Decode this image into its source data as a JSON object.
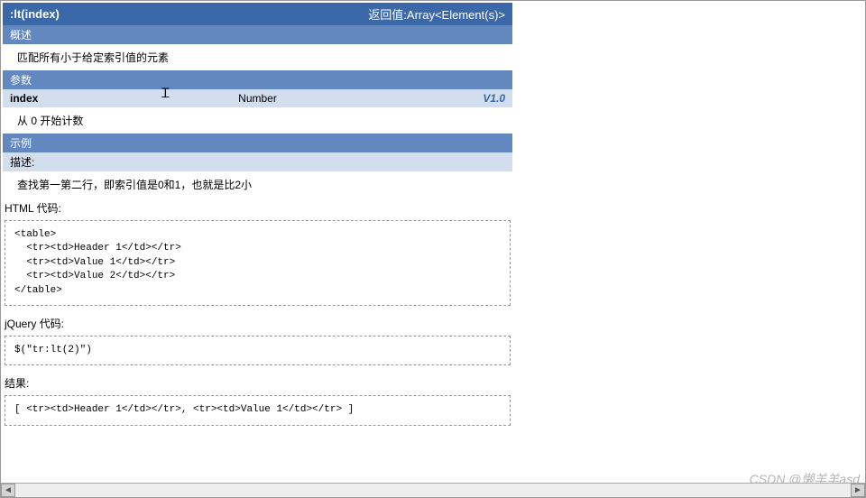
{
  "title": ":lt(index)",
  "return_label": "返回值:Array<Element(s)>",
  "sections": {
    "overview": "概述",
    "params": "参数",
    "example": "示例"
  },
  "overview_text": "匹配所有小于给定索引值的元素",
  "param": {
    "name": "index",
    "type": "Number",
    "version": "V1.0",
    "desc": "从 0 开始计数"
  },
  "example": {
    "desc_label": "描述:",
    "desc_text": "查找第一第二行，即索引值是0和1，也就是比2小",
    "html_label": "HTML 代码:",
    "html_code": "<table>\n  <tr><td>Header 1</td></tr>\n  <tr><td>Value 1</td></tr>\n  <tr><td>Value 2</td></tr>\n</table>",
    "jquery_label": "jQuery 代码:",
    "jquery_code": "$(\"tr:lt(2)\")",
    "result_label": "结果:",
    "result_code": "[ <tr><td>Header 1</td></tr>, <tr><td>Value 1</td></tr> ]"
  },
  "watermark": "CSDN @懒羊羊asd",
  "scroll": {
    "left": "◄",
    "right": "►"
  }
}
